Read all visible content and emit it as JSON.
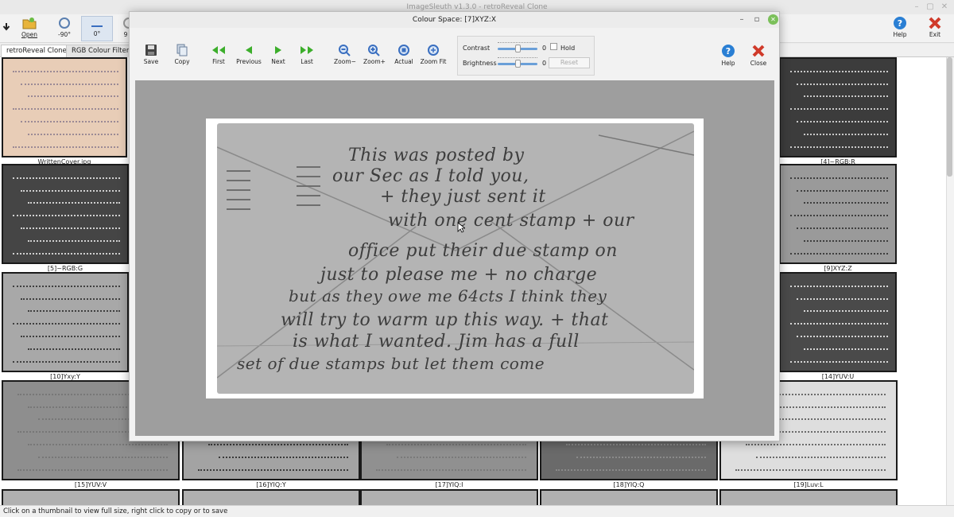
{
  "main_window": {
    "title": "ImageSleuth v1.3.0 - retroReveal Clone",
    "toolbar": {
      "open_label": "Open",
      "rotate_left_label": "-90°",
      "rotate_zero_label": "0°",
      "rotate_right_label": "9",
      "help_label": "Help",
      "exit_label": "Exit"
    },
    "tabs": [
      {
        "label": "retroReveal Clone",
        "active": true
      },
      {
        "label": "RGB Colour Filter",
        "active": false
      }
    ],
    "status": "Click on a thumbnail to view full size, right click to copy or to save"
  },
  "thumbnails": [
    {
      "caption": "WrittenCover.jpg",
      "tone": "#e8cdb7",
      "ink": "#9b8a95"
    },
    {
      "caption": "[4]~RGB:R",
      "tone": "#3c3c3c",
      "ink": "#c9c9c9"
    },
    {
      "caption": "[5]~RGB:G",
      "tone": "#454545",
      "ink": "#d0d0d0"
    },
    {
      "caption": "[9]XYZ:Z",
      "tone": "#9a9a9a",
      "ink": "#3e3e3e"
    },
    {
      "caption": "[10]Yxy:Y",
      "tone": "#a8a8a8",
      "ink": "#3f3f3f"
    },
    {
      "caption": "[14]YUV:U",
      "tone": "#4a4a4a",
      "ink": "#d6d6d6"
    },
    {
      "caption": "[15]YUV:V",
      "tone": "#8e8e8e",
      "ink": "#777777"
    },
    {
      "caption": "[16]YIQ:Y",
      "tone": "#a3a3a3",
      "ink": "#3b3b3b"
    },
    {
      "caption": "[17]YIQ:I",
      "tone": "#909090",
      "ink": "#7a7a7a"
    },
    {
      "caption": "[18]YIQ:Q",
      "tone": "#6a6a6a",
      "ink": "#8a8a8a"
    },
    {
      "caption": "[19]Luv:L",
      "tone": "#dedede",
      "ink": "#6a6a6a"
    }
  ],
  "dialog": {
    "title": "Colour Space: [7]XYZ:X",
    "toolbar": {
      "save": "Save",
      "copy": "Copy",
      "first": "First",
      "previous": "Previous",
      "next": "Next",
      "last": "Last",
      "zoom_minus": "Zoom−",
      "zoom_plus": "Zoom+",
      "actual": "Actual",
      "zoom_fit": "Zoom Fit",
      "help": "Help",
      "close": "Close"
    },
    "adjust": {
      "contrast_label": "Contrast",
      "contrast_value": "0",
      "hold_label": "Hold",
      "hold_checked": false,
      "brightness_label": "Brightness",
      "brightness_value": "0",
      "reset_label": "Reset",
      "contrast_level": 0.5,
      "brightness_level": 0.5
    },
    "handwriting": [
      "This was posted by",
      "our Sec as I told you,",
      "+ they just sent it",
      "with one cent stamp + our",
      "office put their due stamp on",
      "just to please me + no charge",
      "but as they owe me 64cts I think they",
      "will try to warm up this way. + that",
      "is what I wanted. Jim has a full",
      "set of due stamps but let them come"
    ]
  },
  "colors": {
    "accent_blue": "#3a7bd5",
    "help_icon": "#2a7fd4",
    "close_icon": "#d03a2a",
    "arrow_green": "#3cae2b",
    "viewer_bg": "#9e9e9e"
  }
}
